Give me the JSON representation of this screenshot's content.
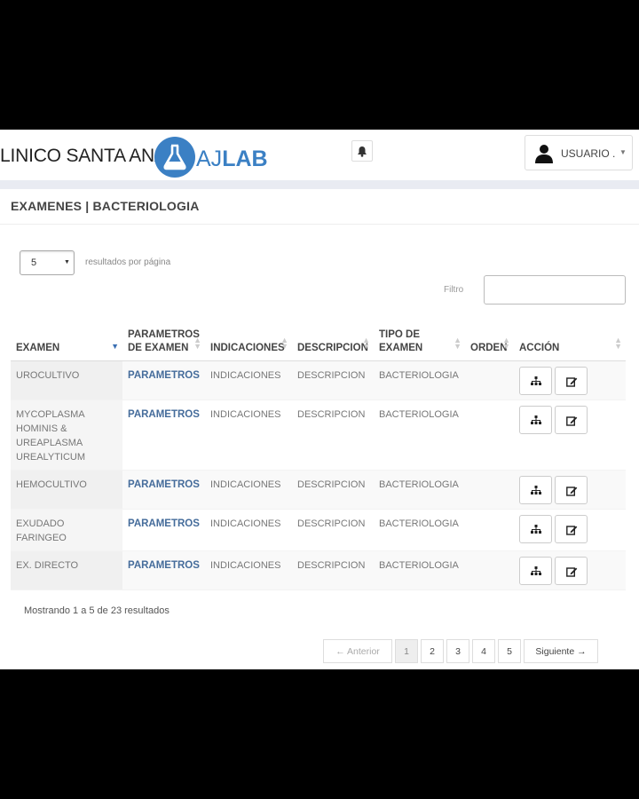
{
  "header": {
    "clinic_name": "LINICO SANTA ANA",
    "brand_aj": "AJ",
    "brand_lab": "LAB",
    "user_label": "USUARIO .",
    "icons": {
      "bell": "bell-icon",
      "user": "user-icon",
      "caret": "caret-down-icon"
    }
  },
  "panel": {
    "title": "EXAMENES | BACTERIOLOGIA"
  },
  "controls": {
    "per_page_value": "5",
    "per_page_label": "resultados por página",
    "filter_label": "Filtro",
    "filter_value": ""
  },
  "table": {
    "columns": [
      {
        "label": "EXAMEN",
        "sort": "asc"
      },
      {
        "label": "PARAMETROS DE EXAMEN",
        "sort": "both"
      },
      {
        "label": "INDICACIONES",
        "sort": "both"
      },
      {
        "label": "DESCRIPCION",
        "sort": "both"
      },
      {
        "label": "TIPO DE EXAMEN",
        "sort": "both"
      },
      {
        "label": "ORDEN",
        "sort": "both"
      },
      {
        "label": "ACCIÓN",
        "sort": "both"
      }
    ],
    "rows": [
      {
        "examen": "UROCULTIVO",
        "parametros": "PARAMETROS",
        "indicaciones": "INDICACIONES",
        "descripcion": "DESCRIPCION",
        "tipo": "BACTERIOLOGIA",
        "orden": ""
      },
      {
        "examen": "MYCOPLASMA HOMINIS & UREAPLASMA UREALYTICUM",
        "parametros": "PARAMETROS",
        "indicaciones": "INDICACIONES",
        "descripcion": "DESCRIPCION",
        "tipo": "BACTERIOLOGIA",
        "orden": ""
      },
      {
        "examen": "HEMOCULTIVO",
        "parametros": "PARAMETROS",
        "indicaciones": "INDICACIONES",
        "descripcion": "DESCRIPCION",
        "tipo": "BACTERIOLOGIA",
        "orden": ""
      },
      {
        "examen": "EXUDADO FARINGEO",
        "parametros": "PARAMETROS",
        "indicaciones": "INDICACIONES",
        "descripcion": "DESCRIPCION",
        "tipo": "BACTERIOLOGIA",
        "orden": ""
      },
      {
        "examen": "EX. DIRECTO",
        "parametros": "PARAMETROS",
        "indicaciones": "INDICACIONES",
        "descripcion": "DESCRIPCION",
        "tipo": "BACTERIOLOGIA",
        "orden": ""
      }
    ],
    "action_icons": [
      "sitemap-icon",
      "edit-icon"
    ]
  },
  "info": "Mostrando 1 a 5 de 23 resultados",
  "pagination": {
    "prev": "← Anterior",
    "pages": [
      "1",
      "2",
      "3",
      "4",
      "5"
    ],
    "current": "1",
    "next": "Siguiente →"
  },
  "colors": {
    "brand": "#3b80c4",
    "link": "#456c9b",
    "header_strip": "#e9ebf2"
  }
}
